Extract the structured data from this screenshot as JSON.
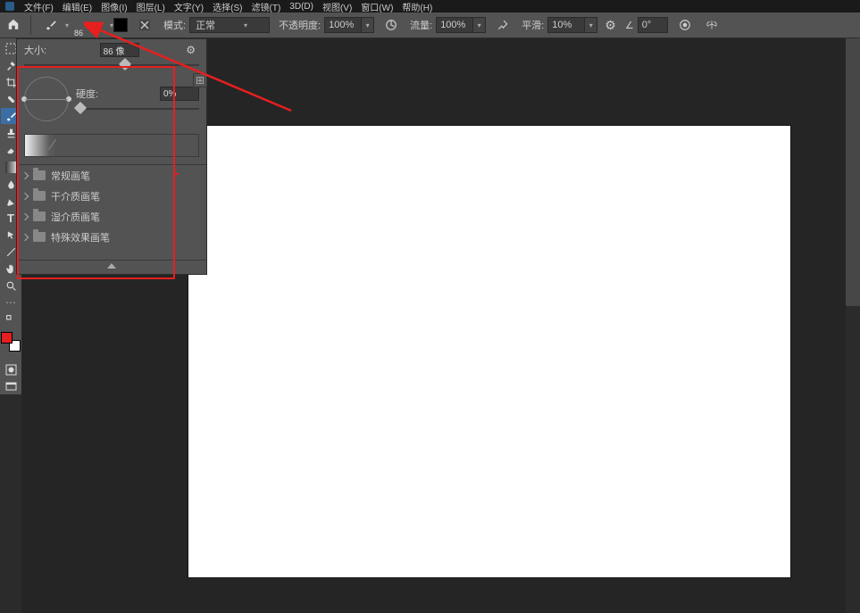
{
  "menu": {
    "items": [
      "文件(F)",
      "编辑(E)",
      "图像(I)",
      "图层(L)",
      "文字(Y)",
      "选择(S)",
      "滤镜(T)",
      "3D(D)",
      "视图(V)",
      "窗口(W)",
      "帮助(H)"
    ]
  },
  "options": {
    "brush_preset_size": "86",
    "mode_label": "模式:",
    "mode_value": "正常",
    "opacity_label": "不透明度:",
    "opacity_value": "100%",
    "flow_label": "流量:",
    "flow_value": "100%",
    "smoothing_label": "平滑:",
    "smoothing_value": "10%",
    "angle_icon": "∠",
    "angle_value": "0°"
  },
  "brush_popup": {
    "size_label": "大小:",
    "size_value": "86 像",
    "hardness_label": "硬度:",
    "hardness_value": "0%",
    "folders": [
      "常规画笔",
      "干介质画笔",
      "湿介质画笔",
      "特殊效果画笔"
    ]
  },
  "tools": {
    "list": [
      "move",
      "marquee",
      "lasso",
      "wand",
      "crop",
      "frame",
      "eyedropper",
      "heal",
      "brush",
      "stamp",
      "history",
      "eraser",
      "gradient",
      "blur",
      "dodge",
      "pen",
      "type",
      "path",
      "shape",
      "hand",
      "zoom"
    ]
  },
  "colors": {
    "foreground": "#e61f1f",
    "background": "#ffffff",
    "highlight": "#e61f1f"
  }
}
